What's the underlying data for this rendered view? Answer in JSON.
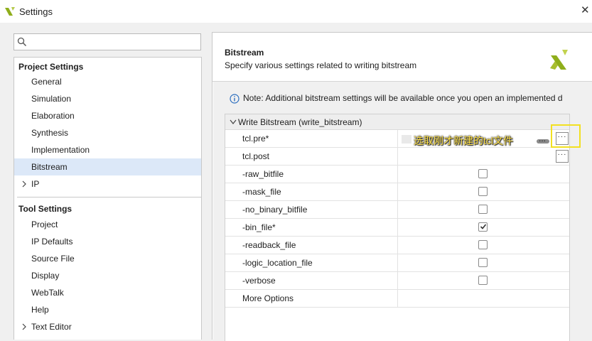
{
  "window": {
    "title": "Settings",
    "close_label": "✕"
  },
  "search": {
    "value": "",
    "placeholder": ""
  },
  "nav": {
    "project_settings_heading": "Project Settings",
    "project_items": [
      "General",
      "Simulation",
      "Elaboration",
      "Synthesis",
      "Implementation",
      "Bitstream",
      "IP"
    ],
    "selected": "Bitstream",
    "tool_settings_heading": "Tool Settings",
    "tool_items": [
      "Project",
      "IP Defaults",
      "Source File",
      "Display",
      "WebTalk",
      "Help",
      "Text Editor"
    ]
  },
  "page": {
    "title": "Bitstream",
    "description": "Specify various settings related to writing bitstream",
    "note": "Note: Additional bitstream settings will be available once you open an implemented d"
  },
  "grid": {
    "section_title": "Write Bitstream (write_bitstream)",
    "rows": [
      {
        "name": "tcl.pre*",
        "control": "browse",
        "button_label": "···"
      },
      {
        "name": "tcl.post",
        "control": "browse",
        "button_label": "···"
      },
      {
        "name": "-raw_bitfile",
        "control": "checkbox",
        "checked": false
      },
      {
        "name": "-mask_file",
        "control": "checkbox",
        "checked": false
      },
      {
        "name": "-no_binary_bitfile",
        "control": "checkbox",
        "checked": false
      },
      {
        "name": "-bin_file*",
        "control": "checkbox",
        "checked": true
      },
      {
        "name": "-readback_file",
        "control": "checkbox",
        "checked": false
      },
      {
        "name": "-logic_location_file",
        "control": "checkbox",
        "checked": false
      },
      {
        "name": "-verbose",
        "control": "checkbox",
        "checked": false
      },
      {
        "name": "More Options",
        "control": "none"
      }
    ]
  },
  "annotation": {
    "text": "选取刚才新建的tcl文件",
    "ellipsis": "..."
  },
  "colors": {
    "selection": "#dce8f8",
    "brand": "#8fae1b",
    "annotation_box": "#f2e021"
  }
}
